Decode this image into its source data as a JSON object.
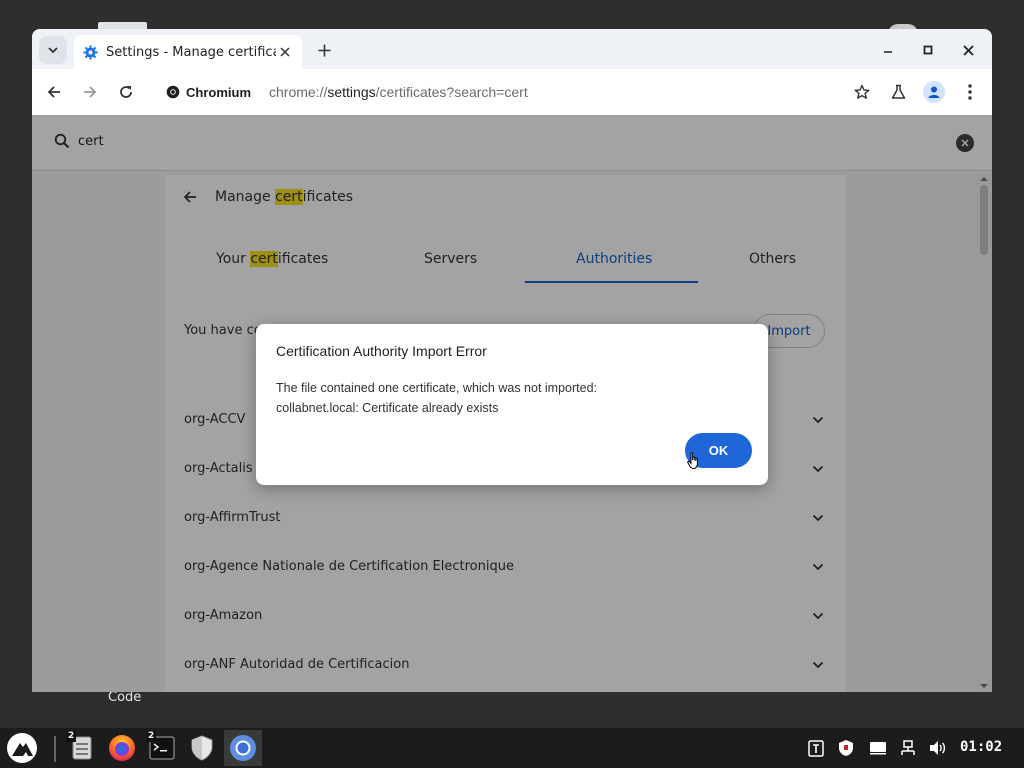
{
  "desktop": {
    "label": "Code"
  },
  "browser": {
    "tab": {
      "title": "Settings - Manage certificate"
    },
    "omnibox": {
      "chip_label": "Chromium",
      "url_prefix": "chrome://",
      "url_host": "settings",
      "url_path": "/certificates?search=cert"
    }
  },
  "settings": {
    "search": {
      "value": "cert"
    },
    "page_title_prefix": "Manage ",
    "page_title_highlight": "cert",
    "page_title_suffix": "ificates",
    "tabs": [
      {
        "prefix": "Your ",
        "highlight": "cert",
        "suffix": "ificates"
      },
      {
        "label": "Servers"
      },
      {
        "label": "Authorities",
        "active": true
      },
      {
        "label": "Others"
      }
    ],
    "info_text": "You have ce",
    "import_label": "Import",
    "authorities": [
      "org-ACCV",
      "org-Actalis S",
      "org-AffirmTrust",
      "org-Agence Nationale de Certification Electronique",
      "org-Amazon",
      "org-ANF Autoridad de Certificacion"
    ]
  },
  "dialog": {
    "title": "Certification Authority Import Error",
    "line1": "The file contained one certificate, which was not imported:",
    "line2": "collabnet.local: Certificate already exists",
    "ok_label": "OK"
  },
  "taskbar": {
    "files_badge": "2",
    "terminal_badge": "2",
    "clock": "01:02"
  },
  "colors": {
    "accent": "#1f66d9",
    "tab_active": "#1a5fc8",
    "highlight": "#f8e21a"
  }
}
